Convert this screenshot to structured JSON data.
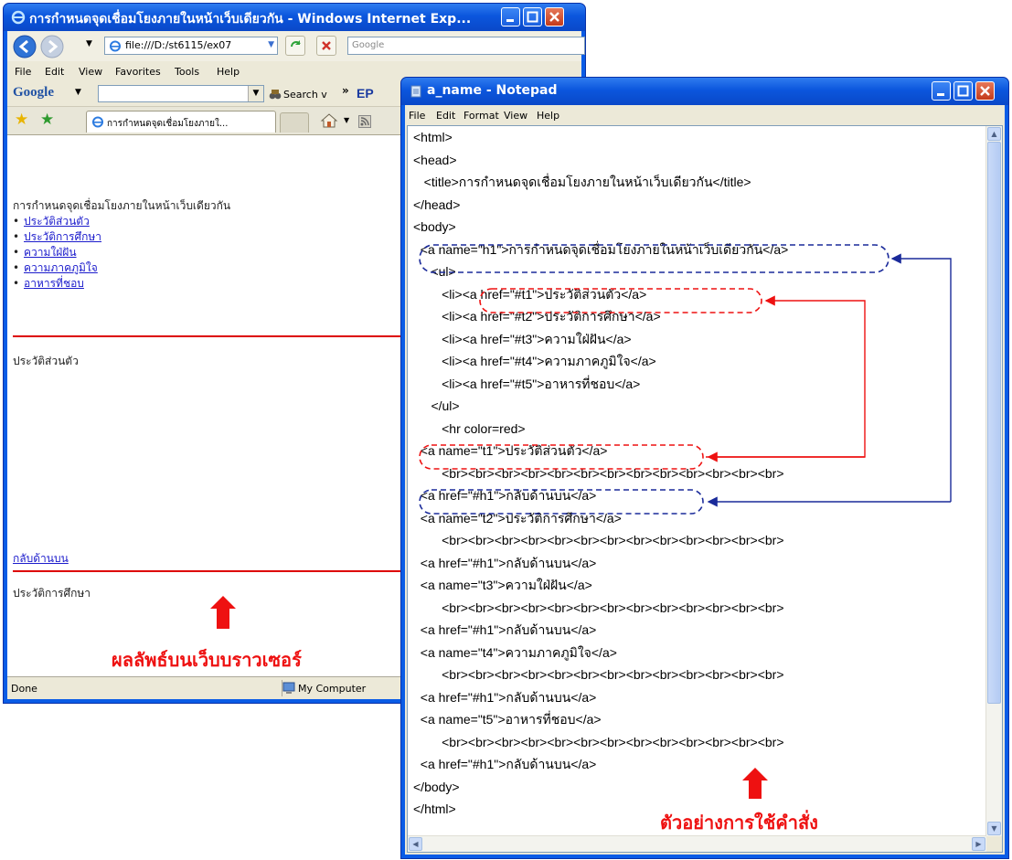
{
  "ie": {
    "title": "การกำหนดจุดเชื่อมโยงภายในหน้าเว็บเดียวกัน - Windows Internet Exp...",
    "address": "file:///D:/st6115/ex07",
    "search_placeholder": "Google",
    "menu": [
      "File",
      "Edit",
      "View",
      "Favorites",
      "Tools",
      "Help"
    ],
    "google_logo": "Google",
    "google_search_label": "Search v",
    "google_more": "»",
    "google_ep": "EP",
    "tab_label": "การกำหนดจุดเชื่อมโยงภายใ...",
    "page": {
      "heading": "การกำหนดจุดเชื่อมโยงภายในหน้าเว็บเดียวกัน",
      "links": [
        "ประวัติส่วนตัว",
        "ประวัติการศึกษา",
        "ความใฝ่ฝัน",
        "ความภาคภูมิใจ",
        "อาหารที่ชอบ"
      ],
      "section1": "ประวัติส่วนตัว",
      "back_link": "กลับด้านบน",
      "section2": "ประวัติการศึกษา"
    },
    "status": {
      "done": "Done",
      "zone": "My Computer"
    },
    "caption": "ผลลัพธ์บนเว็บบราวเซอร์"
  },
  "notepad": {
    "title": "a_name - Notepad",
    "menu": [
      "File",
      "Edit",
      "Format",
      "View",
      "Help"
    ],
    "lines": [
      "<html>",
      "<head>",
      "   <title>การกำหนดจุดเชื่อมโยงภายในหน้าเว็บเดียวกัน</title>",
      "</head>",
      "<body>",
      "  <a name=\"h1\">การกำหนดจุดเชื่อมโยงภายในหน้าเว็บเดียวกัน</a>",
      "     <ul>",
      "        <li><a href=\"#t1\">ประวัติส่วนตัว</a>",
      "        <li><a href=\"#t2\">ประวัติการศึกษา</a>",
      "        <li><a href=\"#t3\">ความใฝ่ฝัน</a>",
      "        <li><a href=\"#t4\">ความภาคภูมิใจ</a>",
      "        <li><a href=\"#t5\">อาหารที่ชอบ</a>",
      "     </ul>",
      "        <hr color=red>",
      "  <a name=\"t1\">ประวัติส่วนตัว</a>",
      "        <br><br><br><br><br><br><br><br><br><br><br><br><br>",
      "  <a href=\"#h1\">กลับด้านบน</a>",
      "  <a name=\"t2\">ประวัติการศึกษา</a>",
      "        <br><br><br><br><br><br><br><br><br><br><br><br><br>",
      "  <a href=\"#h1\">กลับด้านบน</a>",
      "  <a name=\"t3\">ความใฝ่ฝัน</a>",
      "        <br><br><br><br><br><br><br><br><br><br><br><br><br>",
      "  <a href=\"#h1\">กลับด้านบน</a>",
      "  <a name=\"t4\">ความภาคภูมิใจ</a>",
      "        <br><br><br><br><br><br><br><br><br><br><br><br><br>",
      "  <a href=\"#h1\">กลับด้านบน</a>",
      "  <a name=\"t5\">อาหารที่ชอบ</a>",
      "        <br><br><br><br><br><br><br><br><br><br><br><br><br>",
      "  <a href=\"#h1\">กลับด้านบน</a>",
      "</body>",
      "</html>"
    ],
    "caption": "ตัวอย่างการใช้คำสั่ง"
  },
  "colors": {
    "accent_red": "#ee1111",
    "accent_blue": "#1a2a9a",
    "xp_blue": "#0a5ce6"
  }
}
